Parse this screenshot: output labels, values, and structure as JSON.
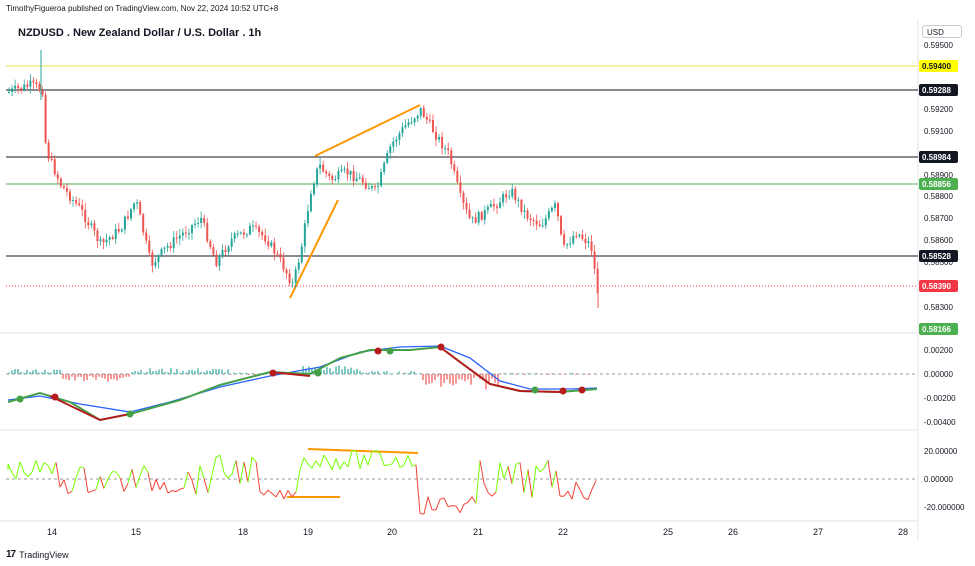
{
  "header": {
    "published": "TimothyFigueroa published on TradingView.com, Nov 22, 2024 10:52 UTC+8",
    "symbol_title": "NZDUSD . New Zealand Dollar / U.S. Dollar . 1h",
    "currency_button": "USD"
  },
  "price_axis": {
    "ticks": [
      "0.59500",
      "0.59300",
      "0.59200",
      "0.59100",
      "0.58900",
      "0.58800",
      "0.58700",
      "0.58600",
      "0.58500",
      "0.58300"
    ],
    "tags": [
      {
        "label": "0.59400",
        "bg": "#ffff00",
        "fg": "#131722",
        "line": "#f0e442"
      },
      {
        "label": "0.59288",
        "bg": "#131722",
        "fg": "#ffffff",
        "line": "#131722"
      },
      {
        "label": "0.58984",
        "bg": "#131722",
        "fg": "#ffffff",
        "line": "#131722"
      },
      {
        "label": "0.58856",
        "bg": "#4caf50",
        "fg": "#ffffff",
        "line": "#4caf50"
      },
      {
        "label": "0.58528",
        "bg": "#131722",
        "fg": "#ffffff",
        "line": "#131722"
      },
      {
        "label": "0.58390",
        "bg": "#f23645",
        "fg": "#ffffff",
        "line": "#f23645"
      },
      {
        "label": "0.58166",
        "bg": "#4caf50",
        "fg": "#ffffff",
        "line": ""
      }
    ]
  },
  "macd_axis": {
    "ticks": [
      "0.00200",
      "0.00000",
      "-0.00200",
      "-0.00400"
    ]
  },
  "rsi_axis": {
    "ticks": [
      "20.00000",
      "0.00000",
      "-20.000000"
    ]
  },
  "time_axis": {
    "labels": [
      "14",
      "15",
      "18",
      "19",
      "20",
      "21",
      "22",
      "25",
      "26",
      "27",
      "28"
    ]
  },
  "footer": {
    "logo": "17",
    "brand": "TradingView"
  },
  "colors": {
    "up": "#26a69a",
    "down": "#ef5350",
    "trend": "#ff9800",
    "macd_line": "#2962ff",
    "signal_fast": "#43a047",
    "signal_slow": "#b71c1c",
    "rsi_up": "#76ff03",
    "rsi_down": "#f44336"
  }
}
